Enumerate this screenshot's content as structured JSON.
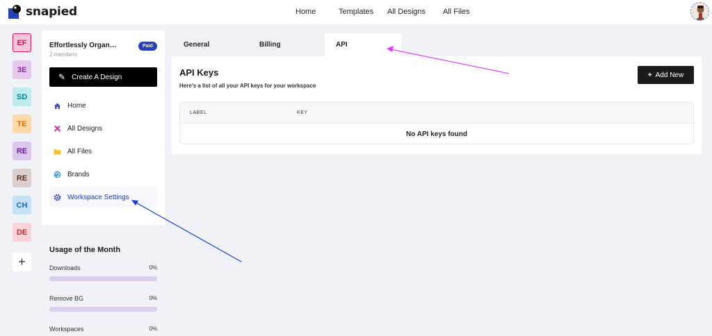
{
  "brand": {
    "name": "snapied"
  },
  "nav": {
    "home": "Home",
    "templates": "Templates",
    "all_designs": "All Designs",
    "all_files": "All Files"
  },
  "workspaces": [
    {
      "initials": "EF",
      "bg": "#f7c6d9",
      "fg": "#c2185b",
      "selected": true
    },
    {
      "initials": "3E",
      "bg": "#e6c8ee",
      "fg": "#8e24aa"
    },
    {
      "initials": "SD",
      "bg": "#bfeaf0",
      "fg": "#00838f"
    },
    {
      "initials": "TE",
      "bg": "#fdd9a8",
      "fg": "#ef6c00"
    },
    {
      "initials": "RE",
      "bg": "#dcc6ee",
      "fg": "#6a1b9a"
    },
    {
      "initials": "RE",
      "bg": "#ddd0cc",
      "fg": "#4e342e"
    },
    {
      "initials": "CH",
      "bg": "#c6e0f7",
      "fg": "#1565c0"
    },
    {
      "initials": "DE",
      "bg": "#fbd3d6",
      "fg": "#c62828"
    }
  ],
  "workspace_add_label": "+",
  "sidebar": {
    "workspace_name": "Effortlessly Organ…",
    "members": "2 members",
    "badge": "Paid",
    "create_label": "Create A Design",
    "items": [
      {
        "label": "Home",
        "icon": "home-icon"
      },
      {
        "label": "All Designs",
        "icon": "designs-icon"
      },
      {
        "label": "All Files",
        "icon": "folder-icon"
      },
      {
        "label": "Brands",
        "icon": "palette-icon"
      },
      {
        "label": "Workspace Settings",
        "icon": "gear-icon",
        "active": true
      }
    ]
  },
  "usage": {
    "title": "Usage of the Month",
    "rows": [
      {
        "label": "Downloads",
        "value": "0%",
        "fraction": 0
      },
      {
        "label": "Remove BG",
        "value": "0%",
        "fraction": 0
      },
      {
        "label": "Workspaces",
        "value": "0%",
        "fraction": 0
      }
    ]
  },
  "tabs": [
    {
      "label": "General"
    },
    {
      "label": "Billing"
    },
    {
      "label": "API",
      "active": true
    }
  ],
  "api_keys": {
    "title": "API Keys",
    "subtitle": "Here's a list of all your API keys for your workspace",
    "add_label": "Add New",
    "columns": [
      "LABEL",
      "KEY"
    ],
    "empty_message": "No API keys found"
  },
  "colors": {
    "accent": "#2541b2",
    "annotation_magenta": "#e040fb",
    "annotation_blue": "#1a3de0"
  }
}
